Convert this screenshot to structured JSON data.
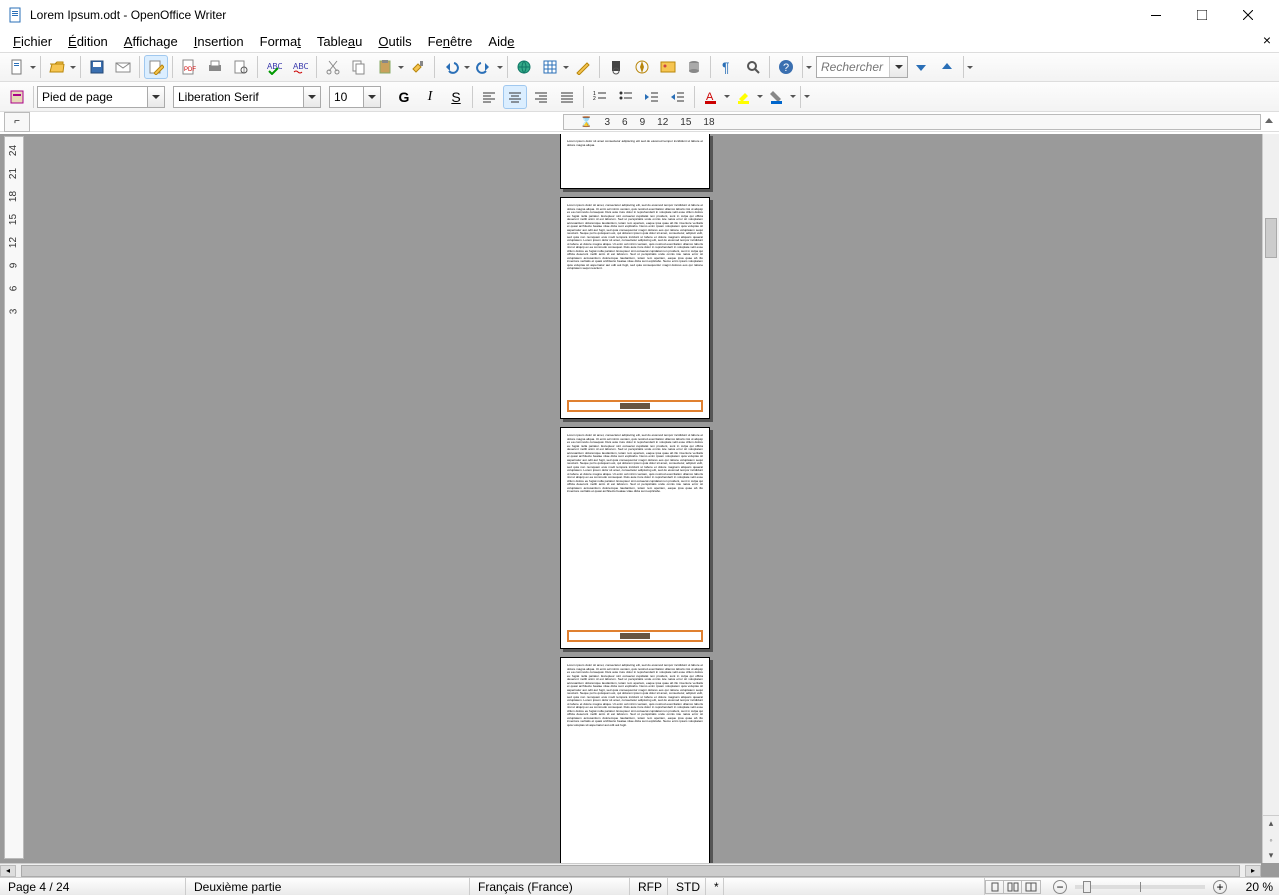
{
  "window": {
    "title": "Lorem Ipsum.odt - OpenOffice Writer"
  },
  "menu": {
    "items": [
      "Fichier",
      "Édition",
      "Affichage",
      "Insertion",
      "Format",
      "Tableau",
      "Outils",
      "Fenêtre",
      "Aide"
    ]
  },
  "toolbar2": {
    "style_combo": "Pied de page",
    "font_combo": "Liberation Serif",
    "size_combo": "10"
  },
  "search": {
    "placeholder": "Rechercher"
  },
  "ruler_h": [
    "3",
    "6",
    "9",
    "12",
    "15",
    "18"
  ],
  "ruler_v": [
    "24",
    "21",
    "18",
    "15",
    "12",
    "9",
    "6",
    "3"
  ],
  "status": {
    "page": "Page 4 / 24",
    "section": "Deuxième partie",
    "language": "Français (France)",
    "mode_rfp": "RFP",
    "mode_std": "STD",
    "mode_star": "*",
    "zoom_pct": "20 %"
  }
}
